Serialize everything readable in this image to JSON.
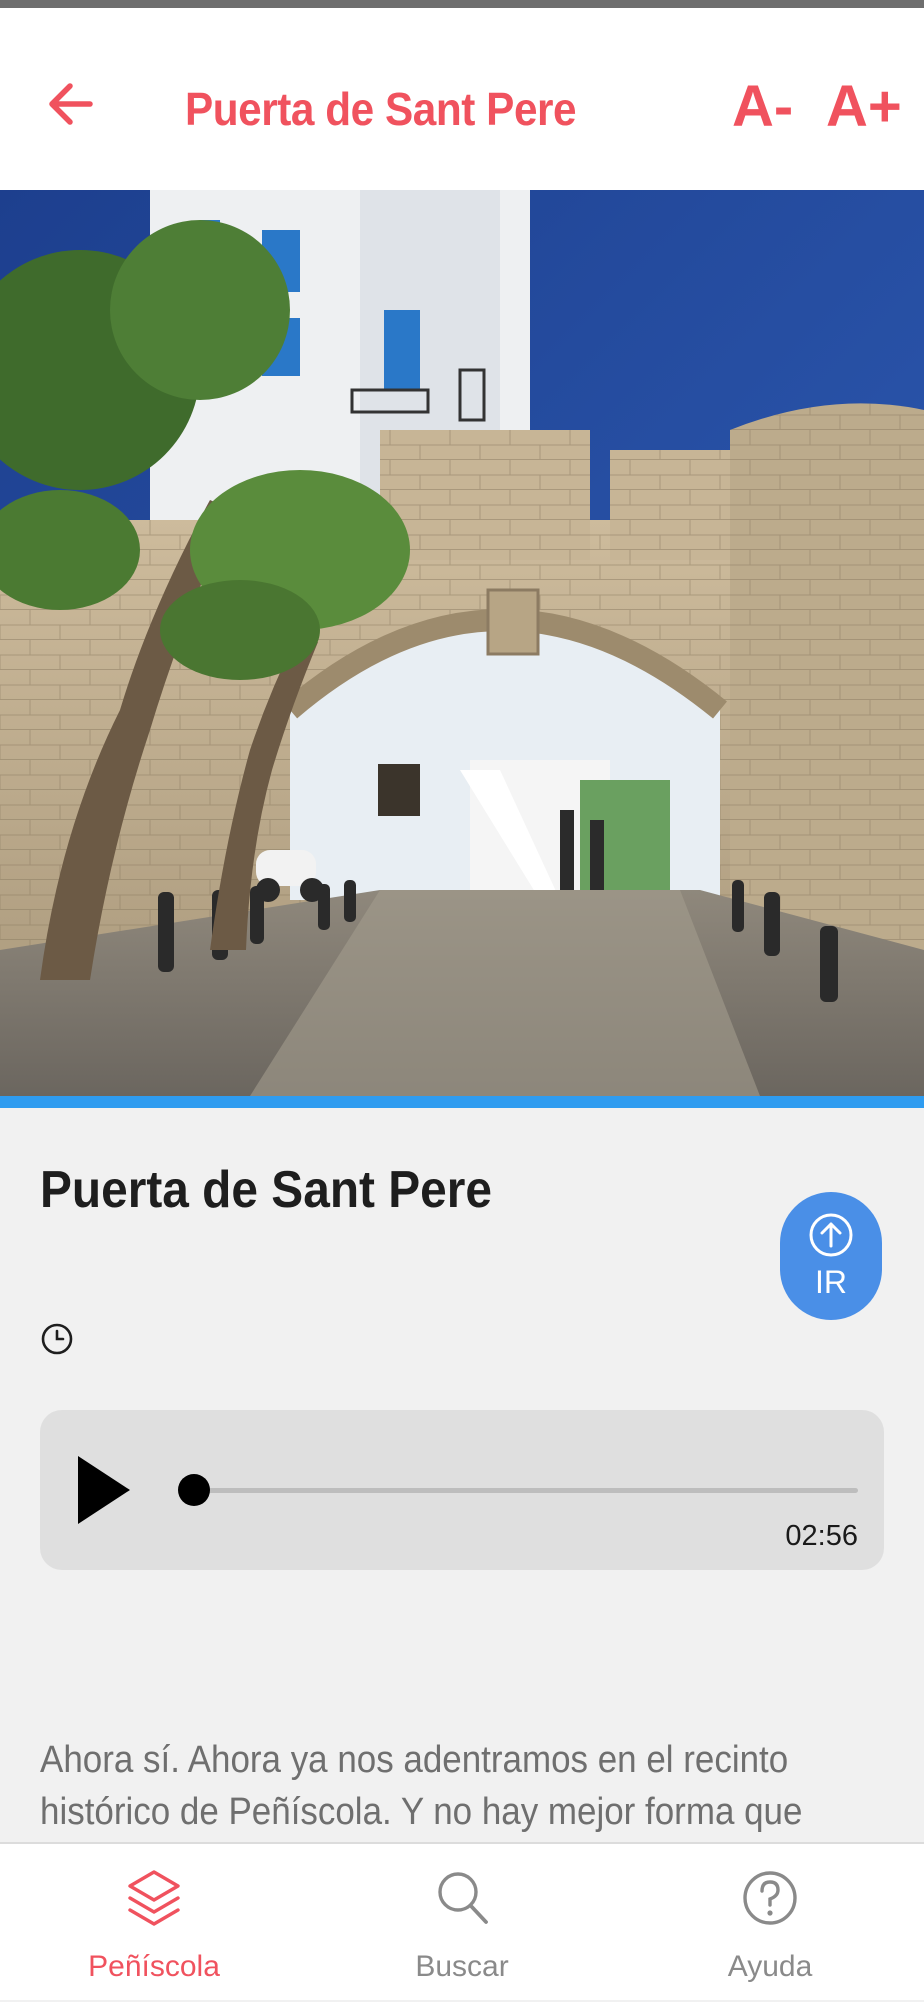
{
  "header": {
    "title": "Puerta de Sant Pere",
    "back_icon": "back-arrow-icon",
    "font_decrease_label": "A-",
    "font_increase_label": "A+",
    "accent_color": "#f0525e"
  },
  "hero": {
    "image": "photo-stone-gate-archway",
    "accent_bar_color": "#2f9cf0"
  },
  "content": {
    "title": "Puerta de Sant Pere",
    "go_button_label": "IR",
    "go_button_icon": "arrow-up-circle-icon",
    "clock_icon": "clock-icon"
  },
  "audio": {
    "play_icon": "play-icon",
    "duration": "02:56",
    "progress": 0
  },
  "description": "Ahora sí. Ahora ya nos adentramos en el recinto histórico de Peñíscola. Y no hay mejor forma que",
  "nav": {
    "items": [
      {
        "label": "Peñíscola",
        "icon": "layers-icon",
        "active": true
      },
      {
        "label": "Buscar",
        "icon": "search-icon",
        "active": false
      },
      {
        "label": "Ayuda",
        "icon": "help-icon",
        "active": false
      }
    ]
  }
}
